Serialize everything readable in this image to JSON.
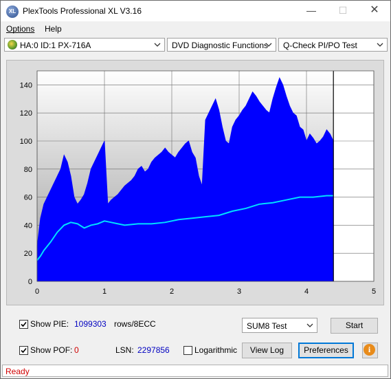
{
  "window": {
    "title": "PlexTools Professional XL V3.16",
    "icon_text": "XL"
  },
  "menu": {
    "options": "Options",
    "help": "Help"
  },
  "toolbar": {
    "drive": "HA:0 ID:1  PX-716A",
    "function": "DVD Diagnostic Functions",
    "test": "Q-Check PI/PO Test"
  },
  "chart_data": {
    "type": "area",
    "x_ticks": [
      "0",
      "1",
      "2",
      "3",
      "4",
      "5"
    ],
    "y_ticks": [
      "0",
      "20",
      "40",
      "60",
      "80",
      "100",
      "120",
      "140"
    ],
    "xlim": [
      0,
      5
    ],
    "ylim": [
      0,
      150
    ],
    "grid": true,
    "end_of_data_x": 4.4,
    "series": [
      {
        "color": "#0000ff",
        "x": [
          0,
          0.05,
          0.1,
          0.15,
          0.2,
          0.25,
          0.3,
          0.35,
          0.4,
          0.45,
          0.5,
          0.55,
          0.6,
          0.65,
          0.7,
          0.75,
          0.8,
          0.85,
          0.9,
          0.95,
          1.0,
          1.05,
          1.1,
          1.15,
          1.2,
          1.25,
          1.3,
          1.35,
          1.4,
          1.45,
          1.5,
          1.55,
          1.6,
          1.65,
          1.7,
          1.75,
          1.8,
          1.85,
          1.9,
          1.95,
          2.0,
          2.05,
          2.1,
          2.15,
          2.2,
          2.25,
          2.3,
          2.35,
          2.4,
          2.45,
          2.5,
          2.55,
          2.6,
          2.65,
          2.7,
          2.75,
          2.8,
          2.85,
          2.9,
          2.95,
          3.0,
          3.05,
          3.1,
          3.15,
          3.2,
          3.25,
          3.3,
          3.35,
          3.4,
          3.45,
          3.5,
          3.55,
          3.6,
          3.65,
          3.7,
          3.75,
          3.8,
          3.85,
          3.9,
          3.95,
          4.0,
          4.05,
          4.1,
          4.15,
          4.2,
          4.25,
          4.3,
          4.35,
          4.4
        ],
        "values": [
          25,
          45,
          55,
          60,
          65,
          70,
          75,
          80,
          90,
          85,
          75,
          60,
          55,
          58,
          62,
          70,
          80,
          85,
          90,
          95,
          100,
          55,
          58,
          60,
          62,
          65,
          68,
          70,
          72,
          75,
          80,
          82,
          78,
          80,
          85,
          88,
          90,
          92,
          95,
          92,
          90,
          88,
          92,
          95,
          98,
          100,
          92,
          88,
          75,
          68,
          115,
          120,
          125,
          130,
          122,
          110,
          100,
          98,
          110,
          115,
          118,
          122,
          125,
          130,
          135,
          132,
          128,
          125,
          122,
          120,
          130,
          138,
          145,
          140,
          132,
          125,
          120,
          118,
          110,
          108,
          100,
          105,
          102,
          98,
          100,
          103,
          108,
          105,
          100
        ]
      },
      {
        "color": "#00e0ff",
        "x": [
          0,
          0.05,
          0.1,
          0.2,
          0.3,
          0.4,
          0.5,
          0.6,
          0.7,
          0.8,
          0.9,
          1.0,
          1.1,
          1.2,
          1.3,
          1.5,
          1.7,
          1.9,
          2.1,
          2.3,
          2.5,
          2.7,
          2.9,
          3.1,
          3.3,
          3.5,
          3.7,
          3.9,
          4.1,
          4.3,
          4.4
        ],
        "values": [
          15,
          18,
          22,
          28,
          35,
          40,
          42,
          41,
          38,
          40,
          41,
          43,
          42,
          41,
          40,
          41,
          41,
          42,
          44,
          45,
          46,
          47,
          50,
          52,
          55,
          56,
          58,
          60,
          60,
          61,
          61
        ]
      }
    ]
  },
  "controls": {
    "show_pie_label": "Show PIE:",
    "pie_value": "1099303",
    "pie_unit": "rows/8ECC",
    "show_pof_label": "Show POF:",
    "pof_value": "0",
    "lsn_label": "LSN:",
    "lsn_value": "2297856",
    "logarithmic_label": "Logarithmic",
    "test_select": "SUM8 Test",
    "start_button": "Start",
    "view_log_button": "View Log",
    "preferences_button": "Preferences",
    "info_symbol": "i"
  },
  "status": {
    "text": "Ready"
  }
}
